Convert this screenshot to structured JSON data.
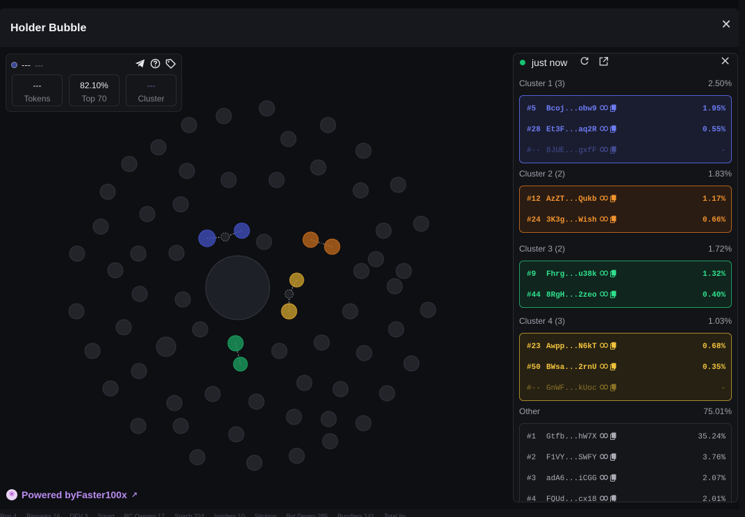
{
  "modal": {
    "title": "Holder Bubble",
    "close_glyph": "✕"
  },
  "token_card": {
    "name": "---",
    "symbol": "---",
    "stats": [
      {
        "value": "---",
        "label": "Tokens"
      },
      {
        "value": "82.10%",
        "label": "Top 70"
      },
      {
        "value": "---",
        "label": "Cluster"
      }
    ],
    "icons": [
      "telegram-icon",
      "help-icon",
      "tag-icon"
    ]
  },
  "powered": {
    "prefix": "Powered by ",
    "brand": "Faster100x",
    "logo_glyph": "❀",
    "ext_glyph": "↗"
  },
  "panel": {
    "status": "just now",
    "icons": [
      "refresh-icon",
      "external-link-icon",
      "close-icon"
    ],
    "sections": [
      {
        "label": "Cluster 1 (3)",
        "pct": "2.50%",
        "border": "#5563d6",
        "bg": "#1a1d30",
        "text": "#6c7bf2",
        "rows": [
          {
            "rank": "#5",
            "addr": "Bcoj...obw9",
            "pct": "1.95%",
            "dim": false
          },
          {
            "rank": "#28",
            "addr": "Et3F...aq2R",
            "pct": "0.55%",
            "dim": false
          },
          {
            "rank": "#--",
            "addr": "8JUE...gxfF",
            "pct": "-",
            "dim": true
          }
        ]
      },
      {
        "label": "Cluster 2 (2)",
        "pct": "1.83%",
        "border": "#b1641f",
        "bg": "#2a1c12",
        "text": "#f0922f",
        "rows": [
          {
            "rank": "#12",
            "addr": "AzZT...Qukb",
            "pct": "1.17%",
            "dim": false
          },
          {
            "rank": "#24",
            "addr": "3K3g...Wish",
            "pct": "0.66%",
            "dim": false
          }
        ]
      },
      {
        "label": "Cluster 3 (2)",
        "pct": "1.72%",
        "border": "#1f9f64",
        "bg": "#10251d",
        "text": "#2fe08d",
        "rows": [
          {
            "rank": "#9",
            "addr": "Fhrg...u38k",
            "pct": "1.32%",
            "dim": false
          },
          {
            "rank": "#44",
            "addr": "8RgH...2zeo",
            "pct": "0.40%",
            "dim": false
          }
        ]
      },
      {
        "label": "Cluster 4 (3)",
        "pct": "1.03%",
        "border": "#a88a2a",
        "bg": "#262113",
        "text": "#f1c23c",
        "rows": [
          {
            "rank": "#23",
            "addr": "Awpp...N6kT",
            "pct": "0.68%",
            "dim": false
          },
          {
            "rank": "#50",
            "addr": "BWsa...2rnU",
            "pct": "0.35%",
            "dim": false
          },
          {
            "rank": "#--",
            "addr": "GnWF...kUoc",
            "pct": "-",
            "dim": true
          }
        ]
      },
      {
        "label": "Other",
        "pct": "75.01%",
        "border": "#2b2d34",
        "bg": "#15161a",
        "text": "#a9acb4",
        "rows": [
          {
            "rank": "#1",
            "addr": "Gtfb...hW7X",
            "pct": "35.24%",
            "dim": false
          },
          {
            "rank": "#2",
            "addr": "F1VY...SWFY",
            "pct": "3.76%",
            "dim": false
          },
          {
            "rank": "#3",
            "addr": "adA6...iCGG",
            "pct": "2.07%",
            "dim": false
          },
          {
            "rank": "#4",
            "addr": "FQUd...cx18",
            "pct": "2.01%",
            "dim": false
          }
        ]
      }
    ]
  },
  "colors": {
    "cluster1": "#3f4cb8",
    "cluster2": "#b8641c",
    "cluster3": "#1a9a5c",
    "cluster4": "#c79b2c",
    "neutral": "#2a2c33"
  },
  "background_tabs": [
    "Ron 4",
    "Remarks 16",
    "DEV 3",
    "Smart",
    "BC Owners 17",
    "Snach 224",
    "Insiders 10",
    "Sticking",
    "Bot Degen 285",
    "Bundlers 141",
    "Total liq"
  ]
}
